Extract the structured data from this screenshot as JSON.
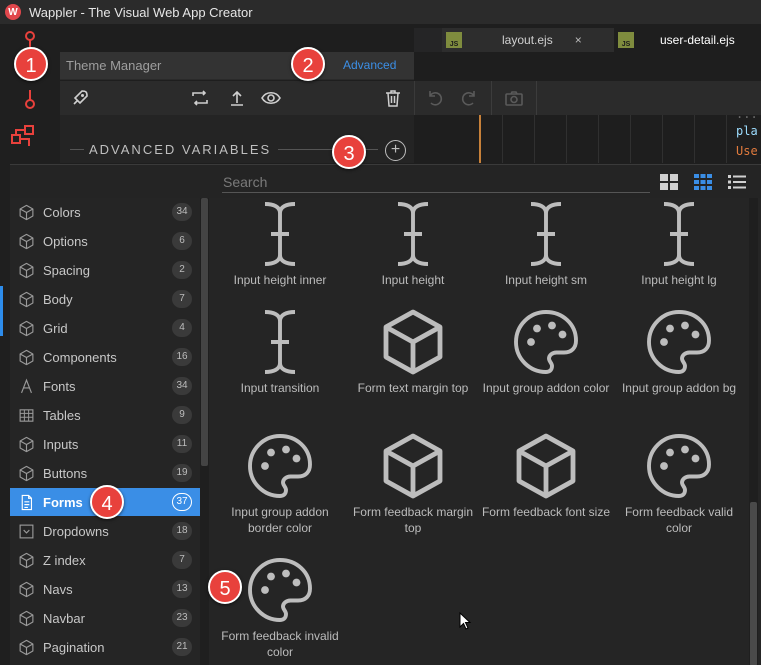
{
  "app": {
    "title": "Wappler - The Visual Web App Creator"
  },
  "editor_tabs": [
    {
      "label": "layout.ejs",
      "badge": "JS",
      "close": "×"
    },
    {
      "label": "user-detail.ejs",
      "badge": "JS"
    }
  ],
  "theme_manager": {
    "title": "Theme Manager",
    "mode_link": "Advanced",
    "toolbar": [
      "rocket-icon",
      "convert-icon",
      "upload-icon",
      "eye-icon",
      "trash-icon"
    ],
    "editor_toolbar": [
      "undo-icon",
      "redo-icon",
      "camera-icon"
    ]
  },
  "advanced": {
    "heading": "ADVANCED VARIABLES",
    "add": "+"
  },
  "code_snippets": [
    "pla",
    "Use",
    "..."
  ],
  "picker": {
    "search_placeholder": "Search",
    "views": [
      "large-grid-view",
      "small-grid-view",
      "list-view"
    ],
    "categories": [
      {
        "label": "Colors",
        "count": "34",
        "icon": "cube-icon"
      },
      {
        "label": "Options",
        "count": "6",
        "icon": "cube-icon"
      },
      {
        "label": "Spacing",
        "count": "2",
        "icon": "cube-icon"
      },
      {
        "label": "Body",
        "count": "7",
        "icon": "cube-icon"
      },
      {
        "label": "Grid",
        "count": "4",
        "icon": "cube-icon"
      },
      {
        "label": "Components",
        "count": "16",
        "icon": "cube-icon"
      },
      {
        "label": "Fonts",
        "count": "34",
        "icon": "font-icon"
      },
      {
        "label": "Tables",
        "count": "9",
        "icon": "table-icon"
      },
      {
        "label": "Inputs",
        "count": "11",
        "icon": "cube-icon"
      },
      {
        "label": "Buttons",
        "count": "19",
        "icon": "cube-icon"
      },
      {
        "label": "Forms",
        "count": "37",
        "icon": "form-icon",
        "active": true
      },
      {
        "label": "Dropdowns",
        "count": "18",
        "icon": "dropdown-icon"
      },
      {
        "label": "Z index",
        "count": "7",
        "icon": "cube-icon"
      },
      {
        "label": "Navs",
        "count": "13",
        "icon": "cube-icon"
      },
      {
        "label": "Navbar",
        "count": "23",
        "icon": "cube-icon"
      },
      {
        "label": "Pagination",
        "count": "21",
        "icon": "cube-icon"
      }
    ],
    "variables": [
      {
        "label": "Input height inner",
        "icon": "i-beam-icon"
      },
      {
        "label": "Input height",
        "icon": "i-beam-icon"
      },
      {
        "label": "Input height sm",
        "icon": "i-beam-icon"
      },
      {
        "label": "Input height lg",
        "icon": "i-beam-icon"
      },
      {
        "label": "Input transition",
        "icon": "i-beam-icon"
      },
      {
        "label": "Form text margin top",
        "icon": "cube-icon"
      },
      {
        "label": "Input group addon color",
        "icon": "palette-icon"
      },
      {
        "label": "Input group addon bg",
        "icon": "palette-icon"
      },
      {
        "label": "Input group addon border color",
        "icon": "palette-icon"
      },
      {
        "label": "Form feedback margin top",
        "icon": "cube-icon"
      },
      {
        "label": "Form feedback font size",
        "icon": "cube-icon"
      },
      {
        "label": "Form feedback valid color",
        "icon": "palette-icon"
      },
      {
        "label": "Form feedback invalid color",
        "icon": "palette-icon"
      }
    ]
  },
  "markers": [
    "1",
    "2",
    "3",
    "4",
    "5"
  ],
  "colors": {
    "accent": "#3a8ee6",
    "link": "#3c8fe6",
    "marker": "#e8413c",
    "bg": "#252525"
  }
}
